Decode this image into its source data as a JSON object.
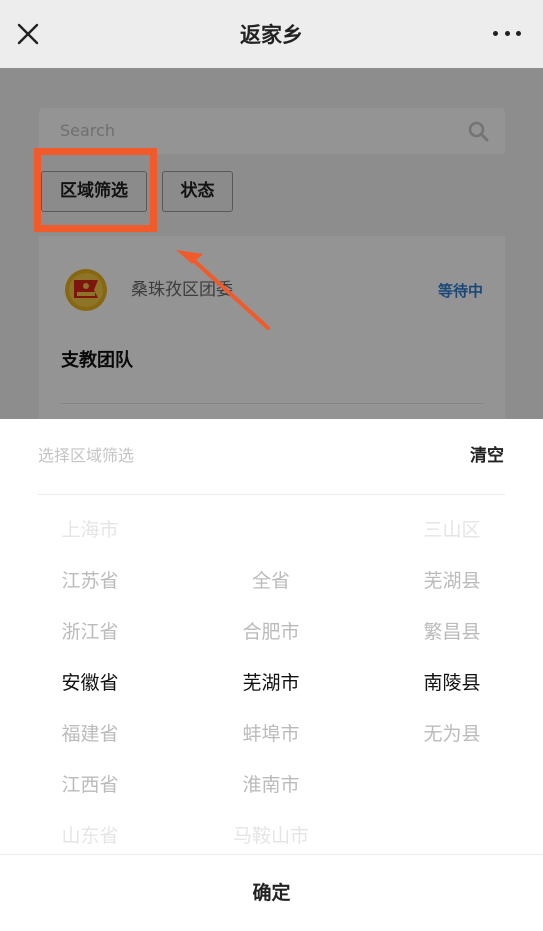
{
  "navbar": {
    "title": "返家乡",
    "close_icon": "close-icon",
    "more_icon": "more-icon"
  },
  "search": {
    "placeholder": "Search",
    "icon": "search-icon"
  },
  "filters": {
    "region_label": "区域筛选",
    "status_label": "状态"
  },
  "card": {
    "org_name": "桑珠孜区团委",
    "status": "等待中",
    "title": "支教团队"
  },
  "picker": {
    "title": "选择区域筛选",
    "clear_label": "清空",
    "confirm_label": "确定",
    "provinces": [
      "上海市",
      "江苏省",
      "浙江省",
      "安徽省",
      "福建省",
      "江西省",
      "山东省"
    ],
    "cities": [
      "",
      "全省",
      "合肥市",
      "芜湖市",
      "蚌埠市",
      "淮南市",
      "马鞍山市"
    ],
    "counties": [
      "三山区",
      "芜湖县",
      "繁昌县",
      "南陵县",
      "无为县",
      "",
      ""
    ],
    "selected": {
      "province": "安徽省",
      "city": "芜湖市",
      "county": "南陵县"
    }
  },
  "colors": {
    "annotation": "#f15a2b",
    "status_blue": "#2e7fd1"
  }
}
